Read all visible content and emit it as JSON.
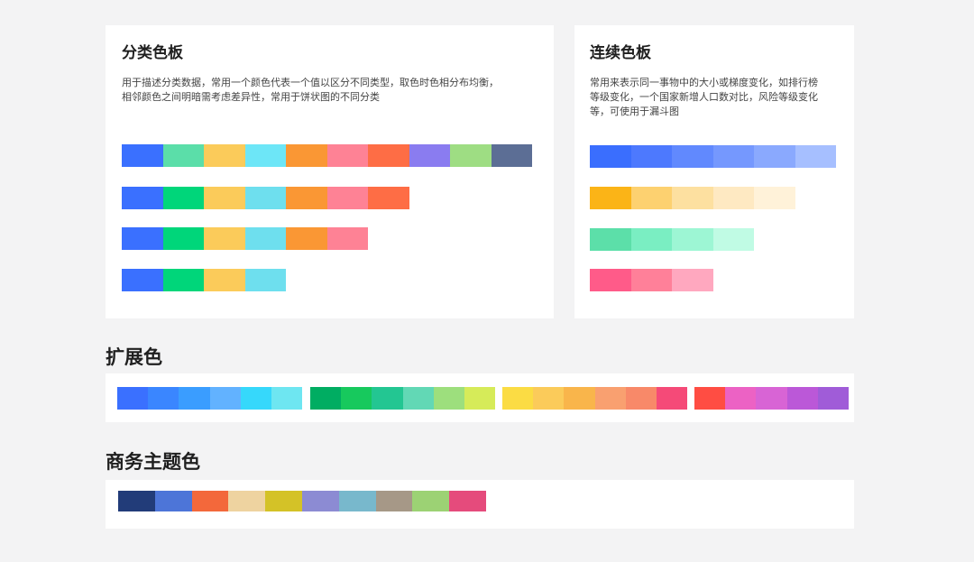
{
  "categorical": {
    "title": "分类色板",
    "desc_line1": "用于描述分类数据，常用一个颜色代表一个值以区分不同类型，取色时色相分布均衡，",
    "desc_line2": "相邻颜色之间明暗需考虑差异性，常用于饼状图的不同分类",
    "rows": [
      [
        "#3a70ff",
        "#5bdea9",
        "#fbcb5a",
        "#6de6f7",
        "#fa9734",
        "#fe8295",
        "#fe6d45",
        "#8a7cf0",
        "#9edd83",
        "#5c6e95"
      ],
      [
        "#3a70ff",
        "#00d67a",
        "#fbcb5a",
        "#6edfee",
        "#fa9734",
        "#fe8295",
        "#fe6d45"
      ],
      [
        "#3a70ff",
        "#00d67a",
        "#fbcb5a",
        "#6edfee",
        "#fa9734",
        "#fe8295"
      ],
      [
        "#3a70ff",
        "#00d67a",
        "#fbcb5a",
        "#6edfee"
      ]
    ]
  },
  "sequential": {
    "title": "连续色板",
    "desc_line1": "常用来表示同一事物中的大小或梯度变化，如排行榜",
    "desc_line2": "等级变化，一个国家新增人口数对比，风险等级变化",
    "desc_line3": "等，可使用于漏斗图",
    "rows": [
      [
        "#3a6efe",
        "#4d79fe",
        "#6189fe",
        "#7598fe",
        "#8aa9fe",
        "#a6bfff"
      ],
      [
        "#fbb417",
        "#fdd170",
        "#fde0a0",
        "#fee9c2",
        "#fff2d9"
      ],
      [
        "#5cdfa9",
        "#7aeec2",
        "#9df6d4",
        "#c0fbe4"
      ],
      [
        "#ff5b89",
        "#ff8099",
        "#ffa8bf"
      ]
    ]
  },
  "extended": {
    "title": "扩展色",
    "groups": [
      [
        "#3a70ff",
        "#3a86ff",
        "#3a9dff",
        "#62b2ff",
        "#36d8fb",
        "#6ee6f1"
      ],
      [
        "#00ad62",
        "#17c95d",
        "#23c692",
        "#62d8b5",
        "#9ddf7d",
        "#d6eb59"
      ],
      [
        "#fbdc44",
        "#fbcb5a",
        "#f9b54b",
        "#f9a070",
        "#f88969",
        "#f54a78"
      ],
      [
        "#ff4d43",
        "#ec62c4",
        "#d864d5",
        "#bb58d8",
        "#a05cd8"
      ]
    ]
  },
  "business": {
    "title": "商务主题色",
    "colors": [
      "#223c79",
      "#4d75d8",
      "#f3683b",
      "#eed3a0",
      "#d4c227",
      "#8c8bd3",
      "#78b8cc",
      "#a69887",
      "#9cd274",
      "#e54b7c"
    ]
  }
}
